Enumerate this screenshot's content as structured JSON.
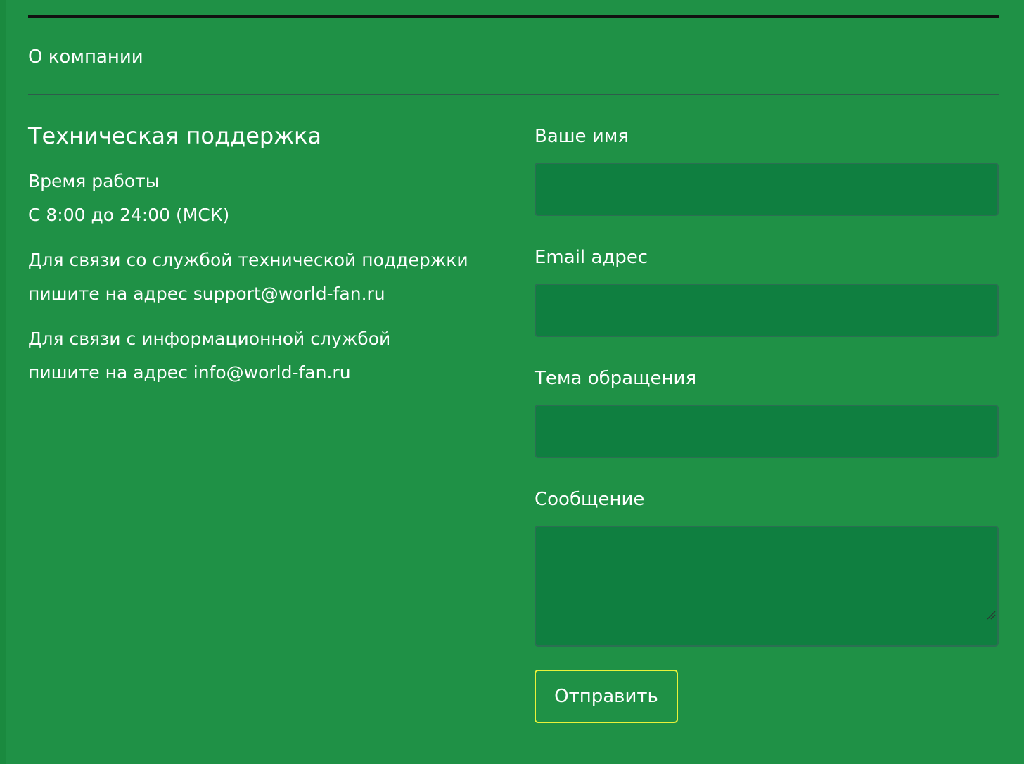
{
  "nav": {
    "about_label": "О компании"
  },
  "support": {
    "title": "Техническая поддержка",
    "hours_label": "Время работы",
    "hours_value": "С 8:00 до 24:00 (МСК)",
    "tech_line1": "Для связи со службой технической поддержки",
    "tech_line2": "пишите на адрес support@world-fan.ru",
    "info_line1": "Для связи с информационной службой",
    "info_line2": "пишите на адрес info@world-fan.ru"
  },
  "form": {
    "name_label": "Ваше имя",
    "name_value": "",
    "email_label": "Email адрес",
    "email_value": "",
    "subject_label": "Тема обращения",
    "subject_value": "",
    "message_label": "Сообщение",
    "message_value": "",
    "submit_label": "Отправить"
  },
  "colors": {
    "background": "#1f9146",
    "input_background": "#0f7f40",
    "button_border": "#e8f23a",
    "top_rule": "#111111"
  }
}
